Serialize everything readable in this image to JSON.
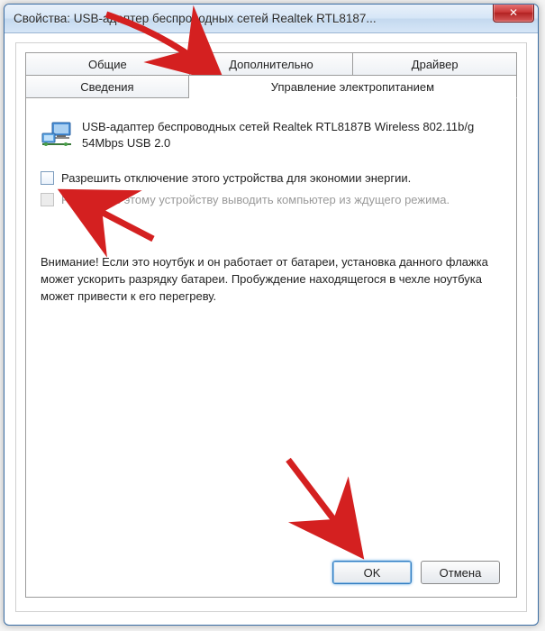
{
  "window": {
    "title": "Свойства: USB-адаптер беспроводных сетей Realtek RTL8187..."
  },
  "tabs": {
    "row1": [
      {
        "label": "Общие"
      },
      {
        "label": "Дополнительно"
      },
      {
        "label": "Драйвер"
      }
    ],
    "row2": [
      {
        "label": "Сведения"
      },
      {
        "label": "Управление электропитанием"
      }
    ]
  },
  "device": {
    "name": "USB-адаптер беспроводных сетей Realtek RTL8187B Wireless 802.11b/g 54Mbps USB 2.0"
  },
  "checkboxes": {
    "allow_off": "Разрешить отключение этого устройства для экономии энергии.",
    "allow_wake": "Разрешить этому устройству выводить компьютер из ждущего режима."
  },
  "warning": "Внимание! Если это ноутбук и он работает от батареи, установка данного флажка может ускорить разрядку батареи. Пробуждение находящегося в чехле ноутбука может привести к его перегреву.",
  "buttons": {
    "ok": "OK",
    "cancel": "Отмена"
  }
}
